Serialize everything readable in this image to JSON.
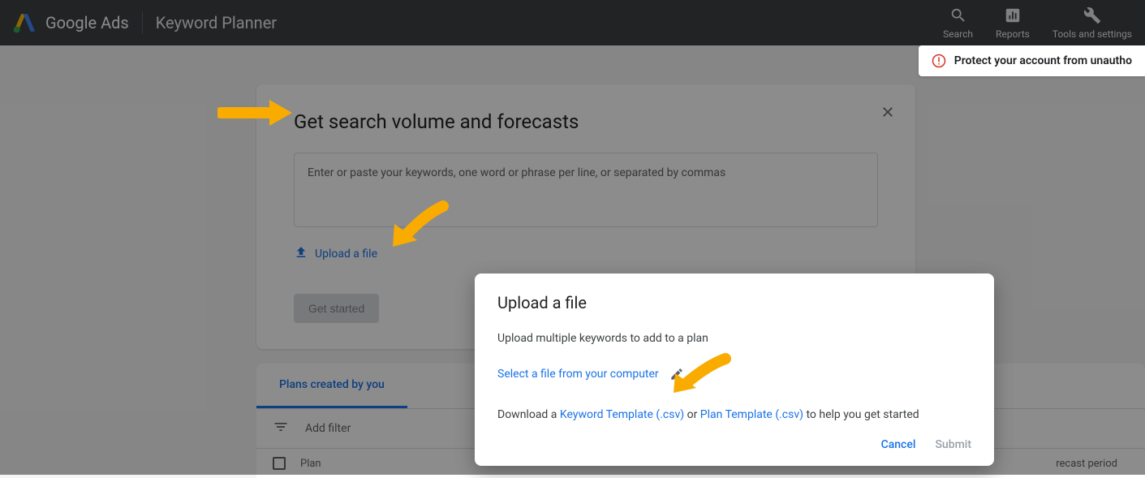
{
  "header": {
    "product": "Google Ads",
    "section": "Keyword Planner",
    "actions": {
      "search": "Search",
      "reports": "Reports",
      "tools": "Tools and settings"
    }
  },
  "notification": {
    "text": "Protect your account from unautho"
  },
  "main_card": {
    "title": "Get search volume and forecasts",
    "placeholder": "Enter or paste your keywords, one word or phrase per line, or separated by commas",
    "upload_link": "Upload a file",
    "get_started": "Get started"
  },
  "plans": {
    "tabs": {
      "created": "Plans created by you"
    },
    "add_filter": "Add filter",
    "columns": {
      "plan": "Plan",
      "forecast": "recast period"
    }
  },
  "dialog": {
    "title": "Upload a file",
    "description": "Upload multiple keywords to add to a plan",
    "select_link": "Select a file from your computer",
    "download_prefix": "Download a ",
    "keyword_template": "Keyword Template (.csv)",
    "or": " or ",
    "plan_template": "Plan Template (.csv)",
    "download_suffix": " to help you get started",
    "cancel": "Cancel",
    "submit": "Submit"
  }
}
